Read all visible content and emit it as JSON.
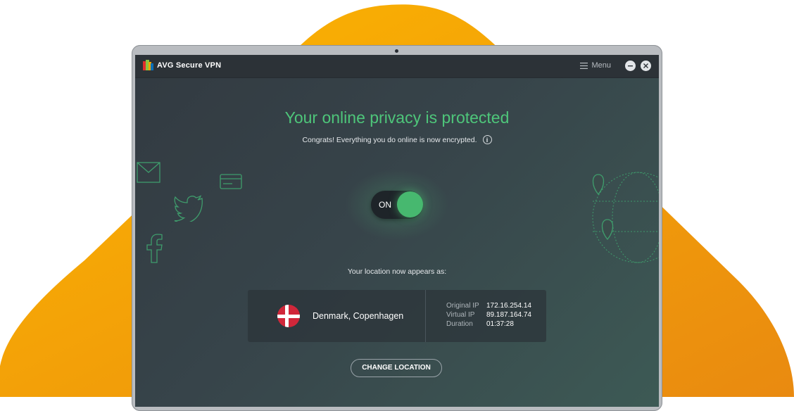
{
  "app": {
    "title": "AVG Secure VPN"
  },
  "titlebar": {
    "menu_label": "Menu",
    "minimize_icon": "minimize-icon",
    "close_icon": "close-icon"
  },
  "status": {
    "headline": "Your online privacy is protected",
    "subline": "Congrats! Everything you do online is now encrypted.",
    "info_glyph": "i"
  },
  "toggle": {
    "state_label": "ON",
    "is_on": true
  },
  "location": {
    "intro": "Your location now appears as:",
    "country_city": "Denmark, Copenhagen",
    "flag_icon": "denmark-flag-icon"
  },
  "connection": {
    "rows": [
      {
        "label": "Original IP",
        "value": "172.16.254.14"
      },
      {
        "label": "Virtual IP",
        "value": "89.187.164.74"
      },
      {
        "label": "Duration",
        "value": "01:37:28"
      }
    ]
  },
  "actions": {
    "change_location": "CHANGE LOCATION"
  },
  "colors": {
    "accent_green": "#4ec67a",
    "brand_orange": "#f7a600",
    "flag_red": "#d0273a"
  }
}
